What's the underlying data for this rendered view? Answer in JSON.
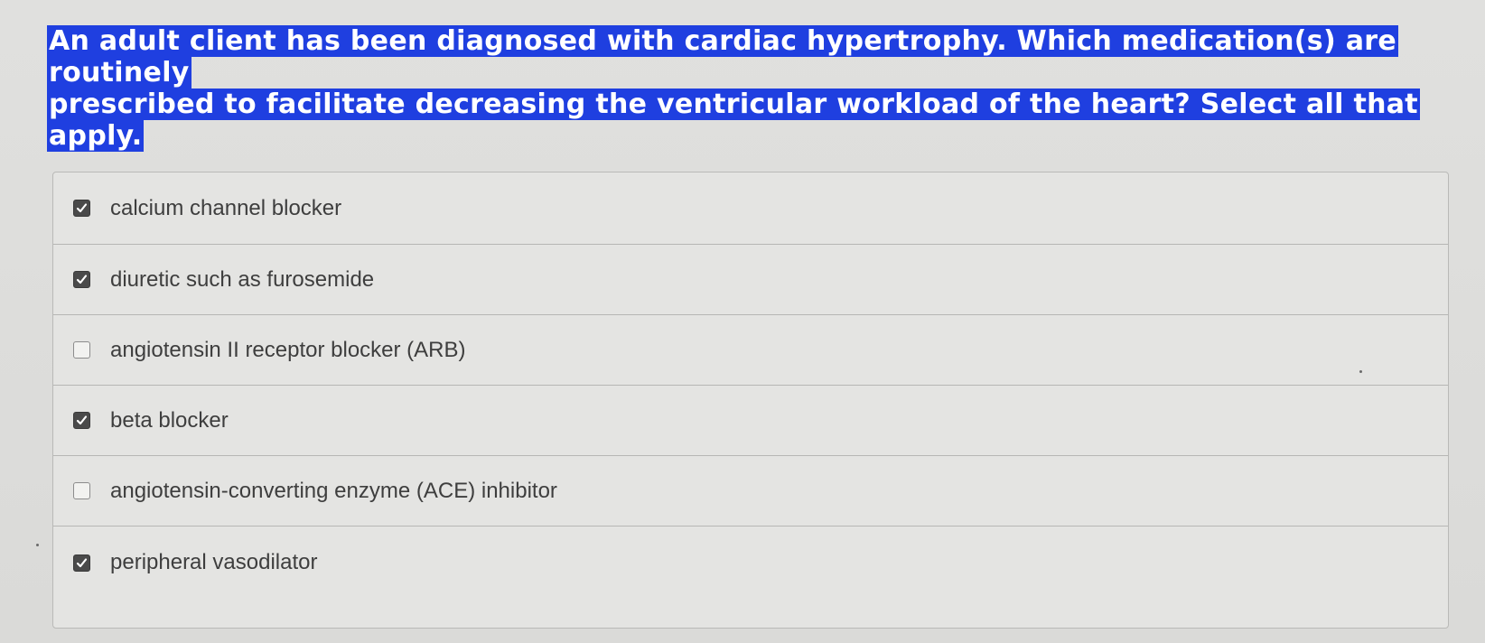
{
  "question": {
    "line1": "An adult client has been diagnosed with cardiac hypertrophy. Which medication(s) are routinely",
    "line2": "prescribed to facilitate decreasing the ventricular workload of the heart? Select all that apply."
  },
  "options": [
    {
      "label": "calcium channel blocker",
      "checked": true
    },
    {
      "label": "diuretic such as furosemide",
      "checked": true
    },
    {
      "label": "angiotensin II receptor blocker (ARB)",
      "checked": false
    },
    {
      "label": "beta blocker",
      "checked": true
    },
    {
      "label": "angiotensin-converting enzyme (ACE) inhibitor",
      "checked": false
    },
    {
      "label": "peripheral vasodilator",
      "checked": true
    }
  ],
  "colors": {
    "highlight": "#1f3fe0",
    "checked_box": "#4a4a4a",
    "text": "#3e3e3e"
  }
}
